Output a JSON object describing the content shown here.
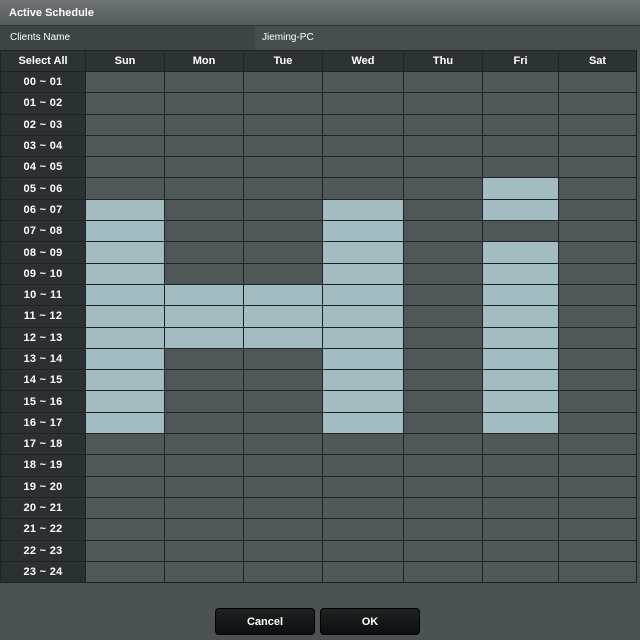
{
  "title": "Active Schedule",
  "client": {
    "label": "Clients Name",
    "value": "Jieming-PC"
  },
  "header": {
    "select_all": "Select All",
    "days": [
      "Sun",
      "Mon",
      "Tue",
      "Wed",
      "Thu",
      "Fri",
      "Sat"
    ]
  },
  "rows": [
    {
      "time": "00 ~ 01",
      "active": [
        0,
        0,
        0,
        0,
        0,
        0,
        0
      ]
    },
    {
      "time": "01 ~ 02",
      "active": [
        0,
        0,
        0,
        0,
        0,
        0,
        0
      ]
    },
    {
      "time": "02 ~ 03",
      "active": [
        0,
        0,
        0,
        0,
        0,
        0,
        0
      ]
    },
    {
      "time": "03 ~ 04",
      "active": [
        0,
        0,
        0,
        0,
        0,
        0,
        0
      ]
    },
    {
      "time": "04 ~ 05",
      "active": [
        0,
        0,
        0,
        0,
        0,
        0,
        0
      ]
    },
    {
      "time": "05 ~ 06",
      "active": [
        0,
        0,
        0,
        0,
        0,
        1,
        0
      ]
    },
    {
      "time": "06 ~ 07",
      "active": [
        1,
        0,
        0,
        1,
        0,
        1,
        0
      ]
    },
    {
      "time": "07 ~ 08",
      "active": [
        1,
        0,
        0,
        1,
        0,
        0,
        0
      ]
    },
    {
      "time": "08 ~ 09",
      "active": [
        1,
        0,
        0,
        1,
        0,
        1,
        0
      ]
    },
    {
      "time": "09 ~ 10",
      "active": [
        1,
        0,
        0,
        1,
        0,
        1,
        0
      ]
    },
    {
      "time": "10 ~ 11",
      "active": [
        1,
        1,
        1,
        1,
        0,
        1,
        0
      ]
    },
    {
      "time": "11 ~ 12",
      "active": [
        1,
        1,
        1,
        1,
        0,
        1,
        0
      ]
    },
    {
      "time": "12 ~ 13",
      "active": [
        1,
        1,
        1,
        1,
        0,
        1,
        0
      ]
    },
    {
      "time": "13 ~ 14",
      "active": [
        1,
        0,
        0,
        1,
        0,
        1,
        0
      ]
    },
    {
      "time": "14 ~ 15",
      "active": [
        1,
        0,
        0,
        1,
        0,
        1,
        0
      ]
    },
    {
      "time": "15 ~ 16",
      "active": [
        1,
        0,
        0,
        1,
        0,
        1,
        0
      ]
    },
    {
      "time": "16 ~ 17",
      "active": [
        1,
        0,
        0,
        1,
        0,
        1,
        0
      ]
    },
    {
      "time": "17 ~ 18",
      "active": [
        0,
        0,
        0,
        0,
        0,
        0,
        0
      ]
    },
    {
      "time": "18 ~ 19",
      "active": [
        0,
        0,
        0,
        0,
        0,
        0,
        0
      ]
    },
    {
      "time": "19 ~ 20",
      "active": [
        0,
        0,
        0,
        0,
        0,
        0,
        0
      ]
    },
    {
      "time": "20 ~ 21",
      "active": [
        0,
        0,
        0,
        0,
        0,
        0,
        0
      ]
    },
    {
      "time": "21 ~ 22",
      "active": [
        0,
        0,
        0,
        0,
        0,
        0,
        0
      ]
    },
    {
      "time": "22 ~ 23",
      "active": [
        0,
        0,
        0,
        0,
        0,
        0,
        0
      ]
    },
    {
      "time": "23 ~ 24",
      "active": [
        0,
        0,
        0,
        0,
        0,
        0,
        0
      ]
    }
  ],
  "buttons": {
    "cancel": "Cancel",
    "ok": "OK"
  },
  "colors": {
    "active_cell": "#a3bcc2",
    "inactive_cell": "#4f5759",
    "time_cell": "#2b3032"
  }
}
